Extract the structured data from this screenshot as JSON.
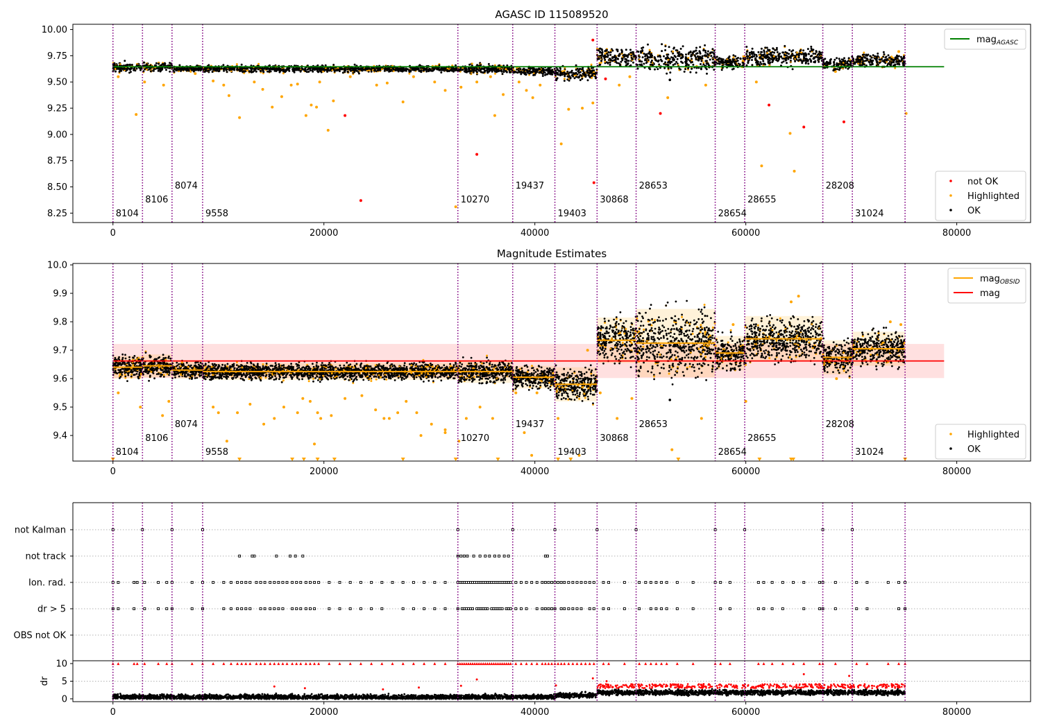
{
  "chart_data": [
    {
      "type": "scatter",
      "title": "AGASC ID 115089520",
      "xlim": [
        -3800,
        87000
      ],
      "ylim": [
        8.16,
        10.05
      ],
      "xticks": [
        0,
        20000,
        40000,
        60000,
        80000
      ],
      "yticks": [
        8.25,
        8.5,
        8.75,
        9.0,
        9.25,
        9.5,
        9.75,
        10.0
      ],
      "ytick_labels": [
        "8.25",
        "8.50",
        "8.75",
        "9.00",
        "9.25",
        "9.50",
        "9.75",
        "10.00"
      ],
      "reference_line": {
        "name": "mag",
        "sub": "AGASC",
        "y": 9.645,
        "x_range": [
          0,
          78800
        ],
        "color": "#008000"
      },
      "legend_upper": [
        {
          "label": "mag",
          "sub": "AGASC",
          "marker": "line",
          "color": "#008000"
        }
      ],
      "legend_lower": [
        {
          "label": "not OK",
          "marker": "dot",
          "color": "#ff0000"
        },
        {
          "label": "Highlighted",
          "marker": "dot",
          "color": "#ffa500"
        },
        {
          "label": "OK",
          "marker": "dot",
          "color": "#000000"
        }
      ],
      "obsids": [
        {
          "x": 0,
          "label": "8104",
          "row": 0
        },
        {
          "x": 2800,
          "label": "8106",
          "row": 1
        },
        {
          "x": 5600,
          "label": "8074",
          "row": 2
        },
        {
          "x": 8500,
          "label": "9558",
          "row": 0
        },
        {
          "x": 32700,
          "label": "10270",
          "row": 1
        },
        {
          "x": 37900,
          "label": "19437",
          "row": 2
        },
        {
          "x": 41900,
          "label": "19403",
          "row": 0
        },
        {
          "x": 45900,
          "label": "30868",
          "row": 1
        },
        {
          "x": 49600,
          "label": "28653",
          "row": 2
        },
        {
          "x": 57100,
          "label": "28654",
          "row": 0
        },
        {
          "x": 59900,
          "label": "28655",
          "row": 1
        },
        {
          "x": 67300,
          "label": "28208",
          "row": 2
        },
        {
          "x": 70100,
          "label": "31024",
          "row": 0
        },
        {
          "x": 75100,
          "label": "",
          "row": 0
        }
      ],
      "segments": [
        {
          "x0": 0,
          "x1": 2800,
          "mean": 9.64,
          "spread": 0.02
        },
        {
          "x0": 2800,
          "x1": 5600,
          "mean": 9.645,
          "spread": 0.02
        },
        {
          "x0": 5600,
          "x1": 8500,
          "mean": 9.63,
          "spread": 0.015
        },
        {
          "x0": 8500,
          "x1": 32700,
          "mean": 9.625,
          "spread": 0.015
        },
        {
          "x0": 32700,
          "x1": 37900,
          "mean": 9.625,
          "spread": 0.02
        },
        {
          "x0": 37900,
          "x1": 41900,
          "mean": 9.605,
          "spread": 0.02
        },
        {
          "x0": 41900,
          "x1": 45900,
          "mean": 9.58,
          "spread": 0.03
        },
        {
          "x0": 45900,
          "x1": 49600,
          "mean": 9.735,
          "spread": 0.04
        },
        {
          "x0": 49600,
          "x1": 57100,
          "mean": 9.725,
          "spread": 0.06
        },
        {
          "x0": 57100,
          "x1": 59900,
          "mean": 9.69,
          "spread": 0.03
        },
        {
          "x0": 59900,
          "x1": 67300,
          "mean": 9.74,
          "spread": 0.04
        },
        {
          "x0": 67300,
          "x1": 70100,
          "mean": 9.675,
          "spread": 0.03
        },
        {
          "x0": 70100,
          "x1": 75100,
          "mean": 9.705,
          "spread": 0.03
        }
      ],
      "highlighted_points": [
        [
          500,
          9.55
        ],
        [
          2200,
          9.19
        ],
        [
          3000,
          9.5
        ],
        [
          4800,
          9.47
        ],
        [
          7800,
          9.58
        ],
        [
          9500,
          9.51
        ],
        [
          10500,
          9.47
        ],
        [
          11000,
          9.37
        ],
        [
          12000,
          9.16
        ],
        [
          13400,
          9.5
        ],
        [
          14200,
          9.43
        ],
        [
          15100,
          9.26
        ],
        [
          16000,
          9.36
        ],
        [
          16900,
          9.47
        ],
        [
          17500,
          9.48
        ],
        [
          18300,
          9.18
        ],
        [
          18800,
          9.28
        ],
        [
          19300,
          9.26
        ],
        [
          19600,
          9.5
        ],
        [
          20400,
          9.04
        ],
        [
          20900,
          9.32
        ],
        [
          22500,
          9.55
        ],
        [
          25000,
          9.47
        ],
        [
          26000,
          9.49
        ],
        [
          27500,
          9.31
        ],
        [
          28500,
          9.55
        ],
        [
          30500,
          9.5
        ],
        [
          31500,
          9.42
        ],
        [
          32500,
          8.31
        ],
        [
          33000,
          9.45
        ],
        [
          34500,
          9.5
        ],
        [
          35800,
          9.55
        ],
        [
          36200,
          9.18
        ],
        [
          37000,
          9.38
        ],
        [
          38500,
          9.5
        ],
        [
          39200,
          9.42
        ],
        [
          39800,
          9.35
        ],
        [
          40500,
          9.47
        ],
        [
          42500,
          8.91
        ],
        [
          43200,
          9.24
        ],
        [
          44500,
          9.25
        ],
        [
          45500,
          9.3
        ],
        [
          48000,
          9.47
        ],
        [
          49000,
          9.55
        ],
        [
          52600,
          9.35
        ],
        [
          56200,
          9.47
        ],
        [
          61000,
          9.5
        ],
        [
          61500,
          8.7
        ],
        [
          64200,
          9.01
        ],
        [
          64600,
          8.65
        ],
        [
          68500,
          9.6
        ],
        [
          74500,
          9.79
        ],
        [
          75200,
          9.2
        ]
      ],
      "notok_points": [
        [
          22000,
          9.18
        ],
        [
          23500,
          8.37
        ],
        [
          34500,
          8.81
        ],
        [
          45500,
          9.9
        ],
        [
          45600,
          8.54
        ],
        [
          46700,
          9.53
        ],
        [
          51900,
          9.2
        ],
        [
          62200,
          9.28
        ],
        [
          65500,
          9.07
        ],
        [
          69300,
          9.12
        ]
      ],
      "outlier_ok_points": [
        [
          52800,
          9.52
        ]
      ]
    },
    {
      "type": "scatter",
      "title": "Magnitude Estimates",
      "xlim": [
        -3800,
        87000
      ],
      "ylim": [
        9.31,
        10.005
      ],
      "xticks": [
        0,
        20000,
        40000,
        60000,
        80000
      ],
      "yticks": [
        9.4,
        9.5,
        9.6,
        9.7,
        9.8,
        9.9,
        10.0
      ],
      "ytick_labels": [
        "9.4",
        "9.5",
        "9.6",
        "9.7",
        "9.8",
        "9.9",
        "10.0"
      ],
      "mag": 9.662,
      "mag_band": [
        9.602,
        9.722
      ],
      "legend_upper": [
        {
          "label": "mag",
          "sub": "OBSID",
          "marker": "line",
          "color": "#ffa500"
        },
        {
          "label": "mag",
          "sub": "",
          "marker": "line",
          "color": "#ff0000"
        }
      ],
      "legend_lower": [
        {
          "label": "Highlighted",
          "marker": "dot",
          "color": "#ffa500"
        },
        {
          "label": "OK",
          "marker": "dot",
          "color": "#000000"
        }
      ],
      "highlighted_points": [
        [
          500,
          9.55
        ],
        [
          2600,
          9.5
        ],
        [
          4700,
          9.47
        ],
        [
          5300,
          9.52
        ],
        [
          9500,
          9.5
        ],
        [
          10000,
          9.48
        ],
        [
          10800,
          9.38
        ],
        [
          11800,
          9.48
        ],
        [
          13000,
          9.51
        ],
        [
          14300,
          9.44
        ],
        [
          15300,
          9.46
        ],
        [
          16200,
          9.5
        ],
        [
          17500,
          9.48
        ],
        [
          18000,
          9.53
        ],
        [
          18700,
          9.52
        ],
        [
          19100,
          9.37
        ],
        [
          19400,
          9.48
        ],
        [
          19700,
          9.46
        ],
        [
          20700,
          9.47
        ],
        [
          22000,
          9.53
        ],
        [
          23600,
          9.54
        ],
        [
          24900,
          9.49
        ],
        [
          25700,
          9.46
        ],
        [
          26200,
          9.46
        ],
        [
          27000,
          9.48
        ],
        [
          27800,
          9.52
        ],
        [
          28800,
          9.48
        ],
        [
          29200,
          9.4
        ],
        [
          30200,
          9.44
        ],
        [
          31500,
          9.41
        ],
        [
          31500,
          9.42
        ],
        [
          32800,
          9.38
        ],
        [
          33500,
          9.46
        ],
        [
          34800,
          9.5
        ],
        [
          36000,
          9.46
        ],
        [
          38200,
          9.55
        ],
        [
          39000,
          9.41
        ],
        [
          39700,
          9.33
        ],
        [
          40200,
          9.55
        ],
        [
          42200,
          9.46
        ],
        [
          44200,
          9.33
        ],
        [
          45000,
          9.7
        ],
        [
          46200,
          9.55
        ],
        [
          47800,
          9.46
        ],
        [
          49200,
          9.53
        ],
        [
          53000,
          9.35
        ],
        [
          55800,
          9.46
        ],
        [
          58800,
          9.79
        ],
        [
          60000,
          9.52
        ],
        [
          64300,
          9.87
        ],
        [
          65000,
          9.89
        ],
        [
          68600,
          9.6
        ],
        [
          73700,
          9.8
        ],
        [
          74700,
          9.79
        ]
      ],
      "down_arrows": [
        0,
        12000,
        17000,
        18100,
        19400,
        21000,
        27500,
        32500,
        36500,
        42200,
        43400,
        53600,
        61300,
        64300,
        64500,
        75100
      ],
      "outlier_ok_points": [
        [
          52800,
          9.525
        ]
      ]
    },
    {
      "type": "scatter",
      "title": "",
      "flag_rows": [
        "not Kalman",
        "not track",
        "Ion. rad.",
        "dr > 5",
        "OBS not OK"
      ],
      "xlim": [
        -3800,
        87000
      ],
      "xticks": [
        0,
        20000,
        40000,
        60000,
        80000
      ],
      "dr_ylabel": "dr",
      "dr_ylim": [
        -0.8,
        10.8
      ],
      "dr_yticks": [
        0,
        5,
        10
      ],
      "not_kalman_x": [
        0,
        2800,
        5600,
        8500,
        32700,
        37900,
        41900,
        45900,
        49600,
        57100,
        59900,
        67300,
        70100
      ],
      "not_track_x": [
        12000,
        13200,
        13400,
        15500,
        16800,
        17300,
        18000,
        32700,
        33000,
        33300,
        33600,
        34200,
        34800,
        35300,
        35700,
        36200,
        36600,
        37100,
        37500,
        41000,
        41200
      ],
      "dr_spikes_x": [
        0,
        500,
        2000,
        2300,
        3000,
        4300,
        5100,
        5600,
        7500,
        8500,
        9500,
        10500,
        11200,
        11800,
        12200,
        12600,
        13000,
        13600,
        14000,
        14400,
        14900,
        15300,
        15700,
        16100,
        16500,
        17000,
        17400,
        17800,
        18300,
        18700,
        19100,
        19500,
        20500,
        21500,
        22500,
        23500,
        24500,
        25500,
        26500,
        27500,
        28500,
        29500,
        30500,
        31500,
        32700,
        32900,
        33100,
        33300,
        33500,
        33700,
        33900,
        34100,
        34300,
        34500,
        34700,
        34900,
        35100,
        35300,
        35500,
        35700,
        35900,
        36100,
        36300,
        36500,
        36700,
        36900,
        37100,
        37300,
        37500,
        37700,
        38200,
        38700,
        39200,
        39700,
        40200,
        40700,
        41000,
        41300,
        41600,
        41900,
        42200,
        42500,
        42800,
        43200,
        43600,
        44000,
        44400,
        44800,
        45200,
        45600,
        46500,
        47000,
        48500,
        49900,
        50500,
        51000,
        51500,
        52000,
        52500,
        53500,
        55000,
        57100,
        57600,
        58500,
        61200,
        61700,
        62500,
        63500,
        64500,
        65500,
        67000,
        67300,
        68500,
        70500,
        71500,
        73500,
        74500,
        75100
      ],
      "dr_red_low": [
        [
          15300,
          3.5
        ],
        [
          18200,
          3.0
        ],
        [
          25600,
          2.7
        ],
        [
          29000,
          3.2
        ],
        [
          33000,
          3.7
        ],
        [
          34500,
          5.5
        ],
        [
          42000,
          3.8
        ],
        [
          45500,
          5.8
        ],
        [
          46800,
          5.0
        ],
        [
          56000,
          4.2
        ],
        [
          65500,
          7.0
        ],
        [
          69800,
          6.5
        ]
      ]
    }
  ]
}
